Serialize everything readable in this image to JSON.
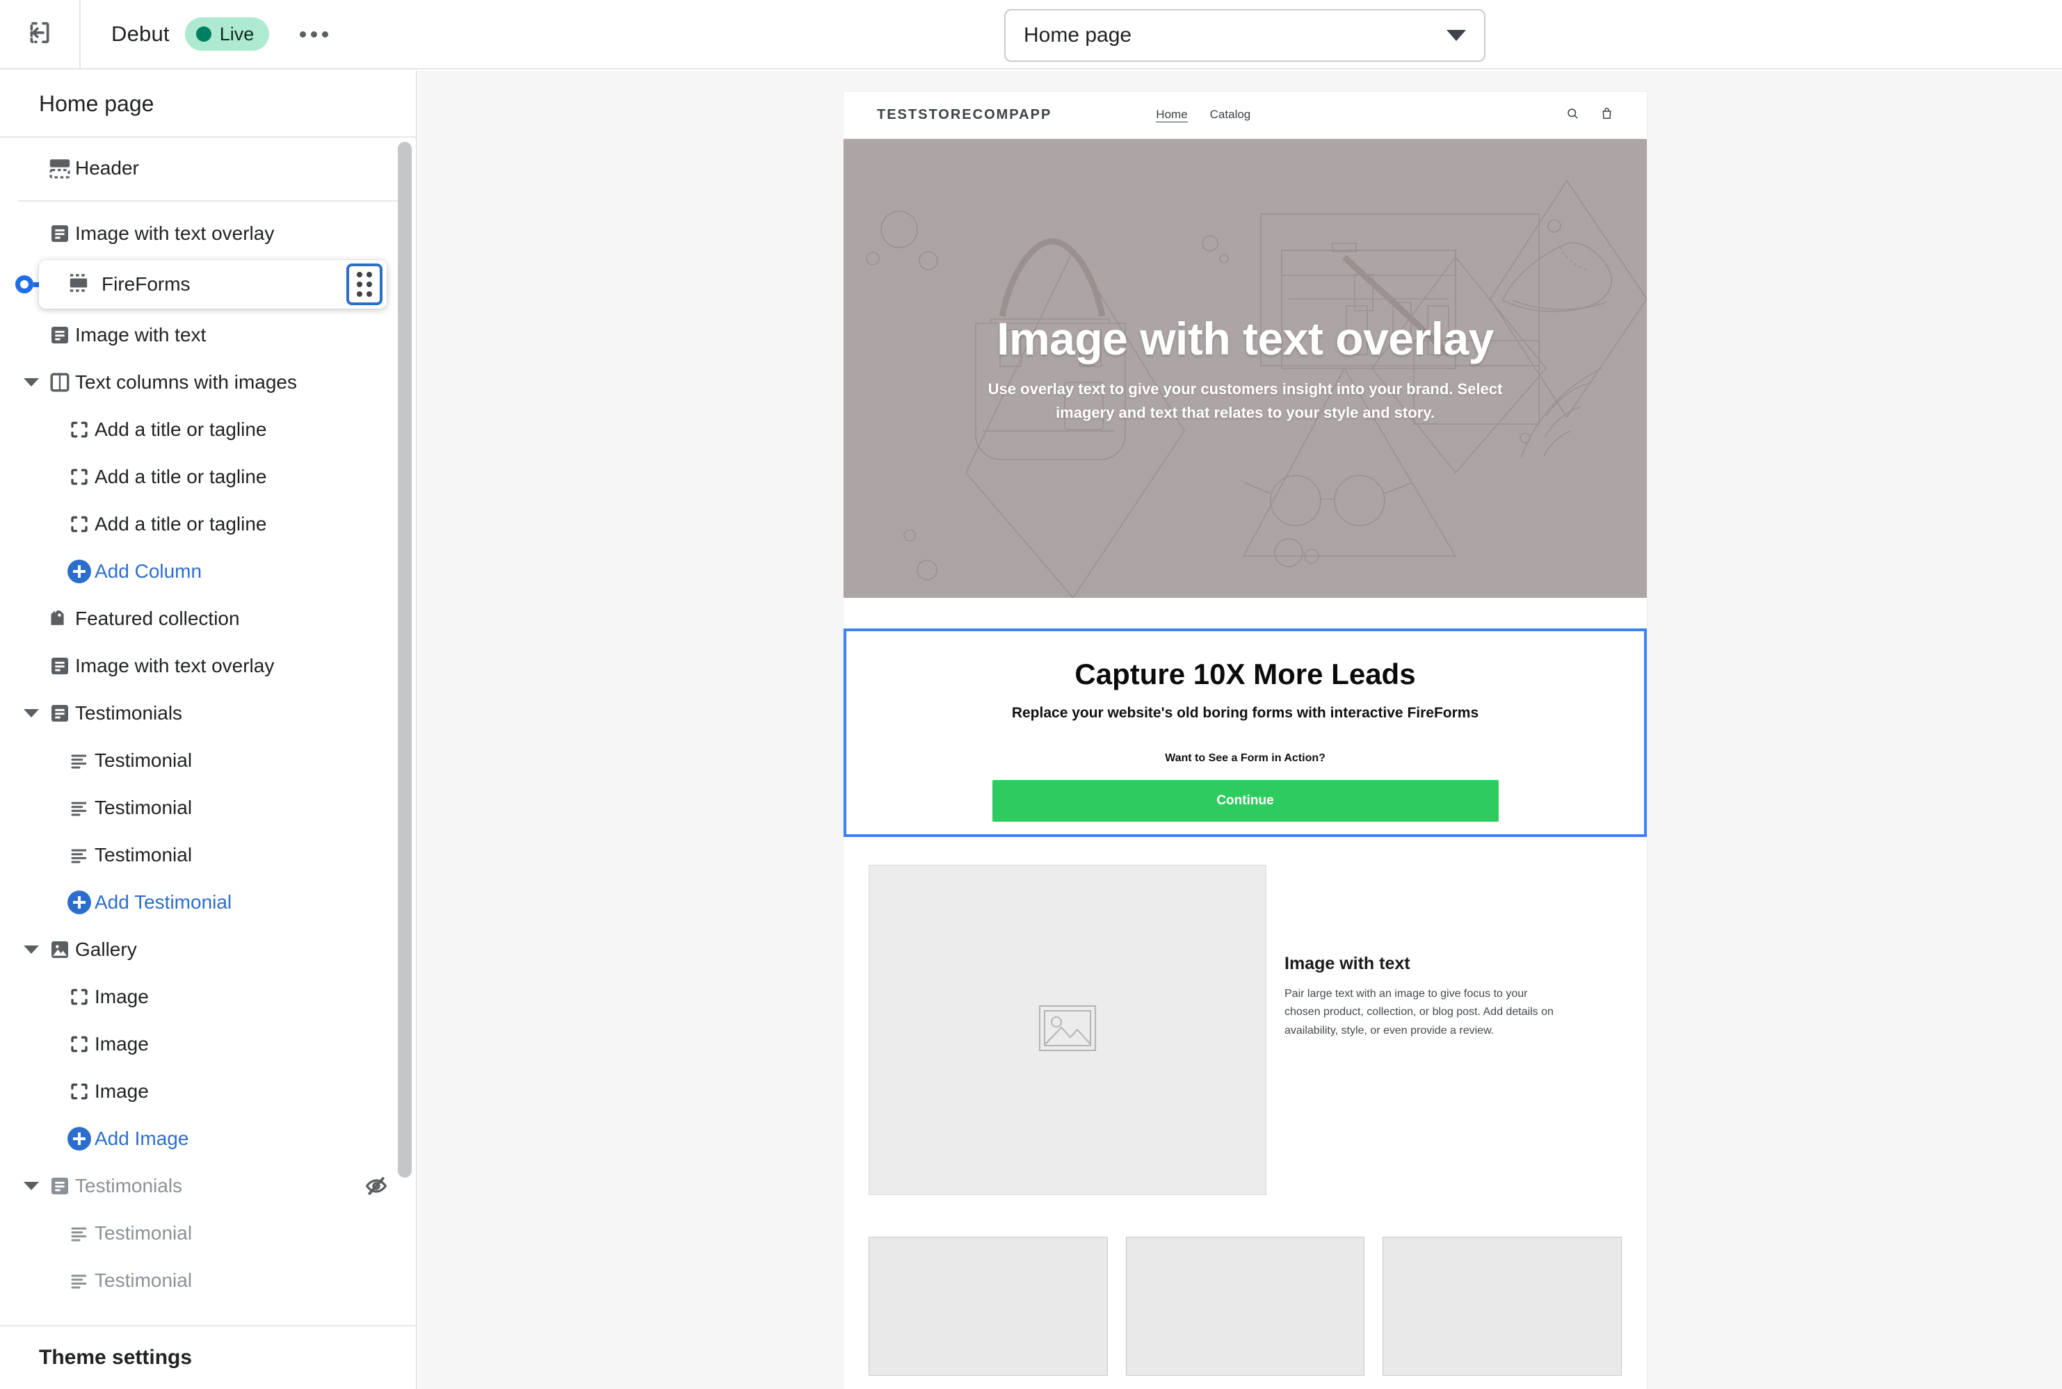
{
  "topbar": {
    "exit_icon": "exit-icon",
    "theme_name": "Debut",
    "status_badge": "Live",
    "more_icon": "ellipsis-icon",
    "page_selector": {
      "value": "Home page",
      "caret_icon": "chevron-down-icon"
    }
  },
  "sidebar": {
    "header_title": "Home page",
    "footer_label": "Theme settings",
    "items": [
      {
        "label": "Header",
        "icon": "header-section-icon",
        "level": 0,
        "type": "section"
      },
      {
        "label": "Image with text overlay",
        "icon": "text-section-icon",
        "level": 0,
        "type": "section"
      },
      {
        "label": "FireForms",
        "icon": "app-block-icon",
        "level": 1,
        "type": "selected-block",
        "drag_handle_icon": "drag-handle-icon"
      },
      {
        "label": "Image with text",
        "icon": "text-section-icon",
        "level": 0,
        "type": "section"
      },
      {
        "label": "Text columns with images",
        "icon": "columns-icon",
        "level": 0,
        "type": "group",
        "twisty": "caret-down-icon"
      },
      {
        "label": "Add a title or tagline",
        "icon": "placeholder-block-icon",
        "level": 1,
        "type": "block"
      },
      {
        "label": "Add a title or tagline",
        "icon": "placeholder-block-icon",
        "level": 1,
        "type": "block"
      },
      {
        "label": "Add a title or tagline",
        "icon": "placeholder-block-icon",
        "level": 1,
        "type": "block"
      },
      {
        "label": "Add Column",
        "icon": "plus-circle-icon",
        "level": 1,
        "type": "add"
      },
      {
        "label": "Featured collection",
        "icon": "collection-tag-icon",
        "level": 0,
        "type": "section"
      },
      {
        "label": "Image with text overlay",
        "icon": "text-section-icon",
        "level": 0,
        "type": "section"
      },
      {
        "label": "Testimonials",
        "icon": "text-section-icon",
        "level": 0,
        "type": "group",
        "twisty": "caret-down-icon"
      },
      {
        "label": "Testimonial",
        "icon": "text-lines-icon",
        "level": 1,
        "type": "block"
      },
      {
        "label": "Testimonial",
        "icon": "text-lines-icon",
        "level": 1,
        "type": "block"
      },
      {
        "label": "Testimonial",
        "icon": "text-lines-icon",
        "level": 1,
        "type": "block"
      },
      {
        "label": "Add Testimonial",
        "icon": "plus-circle-icon",
        "level": 1,
        "type": "add"
      },
      {
        "label": "Gallery",
        "icon": "gallery-image-icon",
        "level": 0,
        "type": "group",
        "twisty": "caret-down-icon"
      },
      {
        "label": "Image",
        "icon": "placeholder-block-icon",
        "level": 1,
        "type": "block"
      },
      {
        "label": "Image",
        "icon": "placeholder-block-icon",
        "level": 1,
        "type": "block"
      },
      {
        "label": "Image",
        "icon": "placeholder-block-icon",
        "level": 1,
        "type": "block"
      },
      {
        "label": "Add Image",
        "icon": "plus-circle-icon",
        "level": 1,
        "type": "add"
      },
      {
        "label": "Testimonials",
        "icon": "text-section-icon",
        "level": 0,
        "type": "group-hidden",
        "twisty": "caret-down-icon",
        "trailing_icon": "eye-hidden-icon"
      },
      {
        "label": "Testimonial",
        "icon": "text-lines-icon",
        "level": 1,
        "type": "block-hidden"
      },
      {
        "label": "Testimonial",
        "icon": "text-lines-icon",
        "level": 1,
        "type": "block-hidden"
      }
    ]
  },
  "preview": {
    "store_header": {
      "logo": "TESTSTORECOMPAPP",
      "nav": [
        {
          "label": "Home",
          "active": true
        },
        {
          "label": "Catalog",
          "active": false
        }
      ],
      "search_icon": "search-icon",
      "cart_icon": "shopping-bag-icon"
    },
    "hero": {
      "title": "Image with text overlay",
      "body": "Use overlay text to give your customers insight into your brand. Select imagery and text that relates to your style and story."
    },
    "fireforms": {
      "heading": "Capture 10X More Leads",
      "subheading": "Replace your website's old boring forms with interactive FireForms",
      "question": "Want to See a Form in Action?",
      "cta_label": "Continue",
      "cta_color": "#2ecc5f",
      "selection_color": "#3b82f6"
    },
    "image_with_text": {
      "image_placeholder_icon": "image-placeholder-icon",
      "heading": "Image with text",
      "body": "Pair large text with an image to give focus to your chosen product, collection, or blog post. Add details on availability, style, or even provide a review."
    },
    "bottom_boxes": 3
  }
}
